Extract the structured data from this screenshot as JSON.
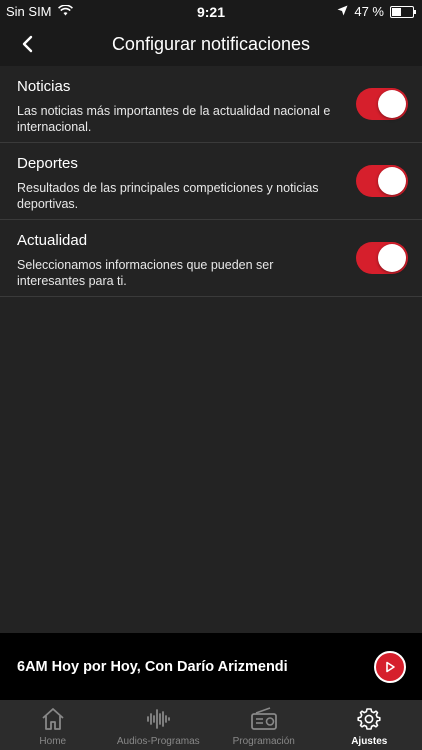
{
  "status_bar": {
    "carrier": "Sin SIM",
    "time": "9:21",
    "battery_percent": "47 %",
    "battery_level": 0.47
  },
  "header": {
    "back_icon": "chevron-left-icon",
    "title": "Configurar notificaciones"
  },
  "settings": [
    {
      "title": "Noticias",
      "description": "Las noticias más importantes de la actualidad nacional e internacional.",
      "enabled": true
    },
    {
      "title": "Deportes",
      "description": "Resultados de las principales competiciones y noticias deportivas.",
      "enabled": true
    },
    {
      "title": "Actualidad",
      "description": "Seleccionamos informaciones que pueden ser interesantes para ti.",
      "enabled": true
    }
  ],
  "now_playing": {
    "title": "6AM Hoy por Hoy, Con Darío Arizmendi",
    "play_icon": "play-icon"
  },
  "tabs": [
    {
      "label": "Home",
      "icon": "home-icon",
      "active": false
    },
    {
      "label": "Audios-Programas",
      "icon": "audio-wave-icon",
      "active": false
    },
    {
      "label": "Programación",
      "icon": "radio-icon",
      "active": false
    },
    {
      "label": "Ajustes",
      "icon": "gear-icon",
      "active": true
    }
  ],
  "colors": {
    "accent": "#d61f2c",
    "background": "#232323",
    "bar": "#1a1a1a",
    "tab_bar": "#2c2c2c"
  }
}
